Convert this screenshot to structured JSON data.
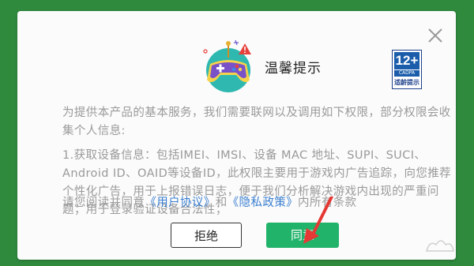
{
  "dialog": {
    "title": "温馨提示",
    "age_badge": {
      "age": "12+",
      "org": "CADPA",
      "label": "适龄提示"
    },
    "paragraph1": "为提供本产品的基本服务，我们需要联网以及调用如下权限，部分权限会收集个人信息:",
    "paragraph2": "1.获取设备信息：包括IMEI、IMSI、设备 MAC 地址、SUPI、SUCI、Android ID、OAID等设备ID，此权限主要用于游戏内广告追踪，向您推荐个性化广告，用于上报错误日志，便于我们分析解决游戏内出现的严重问题；用于登录验证设备合法性；",
    "paragraph3": {
      "prefix": "请您阅读并同意",
      "user_agreement": "《用户协议》",
      "and": "和",
      "privacy_policy": "《隐私政策》",
      "suffix": "内所有条款"
    },
    "buttons": {
      "reject": "拒绝",
      "agree": "同意"
    }
  },
  "colors": {
    "background": "#2f8a3e",
    "agree_button": "#22b36a",
    "link": "#3a7fd0",
    "arrow": "#e53935"
  }
}
